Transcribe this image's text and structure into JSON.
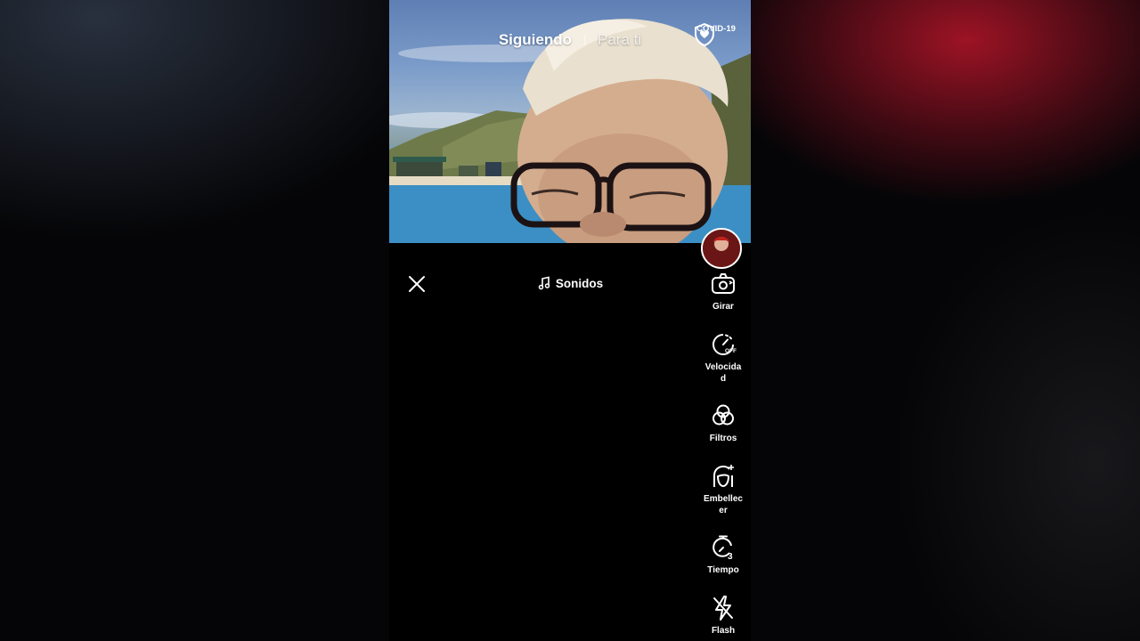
{
  "feed_tabs": {
    "following": "Siguiendo",
    "for_you": "Para ti"
  },
  "covid_badge": {
    "label": "COVID-19",
    "icon": "shield-heart-icon"
  },
  "camera": {
    "close_icon": "close-icon",
    "sounds_label": "Sonidos",
    "sounds_icon": "music-note-icon"
  },
  "tools": [
    {
      "label": "Girar",
      "icon": "flip-camera-icon"
    },
    {
      "label": "Velocidad",
      "icon": "speed-off-icon"
    },
    {
      "label": "Filtros",
      "icon": "filters-icon"
    },
    {
      "label": "Embellecer",
      "icon": "beautify-icon"
    },
    {
      "label": "Tiempo",
      "icon": "timer-3-icon"
    },
    {
      "label": "Flash",
      "icon": "flash-off-icon"
    }
  ],
  "colors": {
    "background": "#000000",
    "text": "#ffffff",
    "accent_red": "#a51426"
  }
}
